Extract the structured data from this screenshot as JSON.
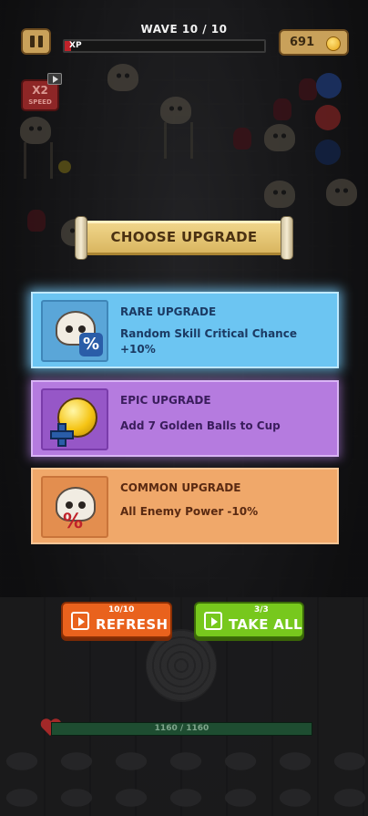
{
  "hud": {
    "wave_label": "WAVE 10 / 10",
    "xp_label": "XP",
    "xp_progress": 0.03,
    "gold": "691",
    "speed": {
      "multiplier": "X2",
      "label": "SPEED"
    }
  },
  "banner": {
    "title": "CHOOSE UPGRADE"
  },
  "upgrades": [
    {
      "rarity": "RARE UPGRADE",
      "description": "Random Skill Critical Chance +10%",
      "color": "#6cc5f2",
      "icon": "skull-percent-icon"
    },
    {
      "rarity": "EPIC UPGRADE",
      "description": "Add 7  Golden Balls to Cup",
      "color": "#b57bdf",
      "icon": "golden-ball-plus-icon"
    },
    {
      "rarity": "COMMON UPGRADE",
      "description": "All Enemy Power -10%",
      "color": "#f0a86a",
      "icon": "skull-percent-icon"
    }
  ],
  "actions": {
    "refresh": {
      "label": "REFRESH",
      "count": "10/10",
      "color": "#e9621d"
    },
    "take_all": {
      "label": "TAKE ALL",
      "count": "3/3",
      "color": "#77c81d"
    }
  },
  "player": {
    "hp_text": "1160  /  1160",
    "hp_fraction": 1.0
  }
}
